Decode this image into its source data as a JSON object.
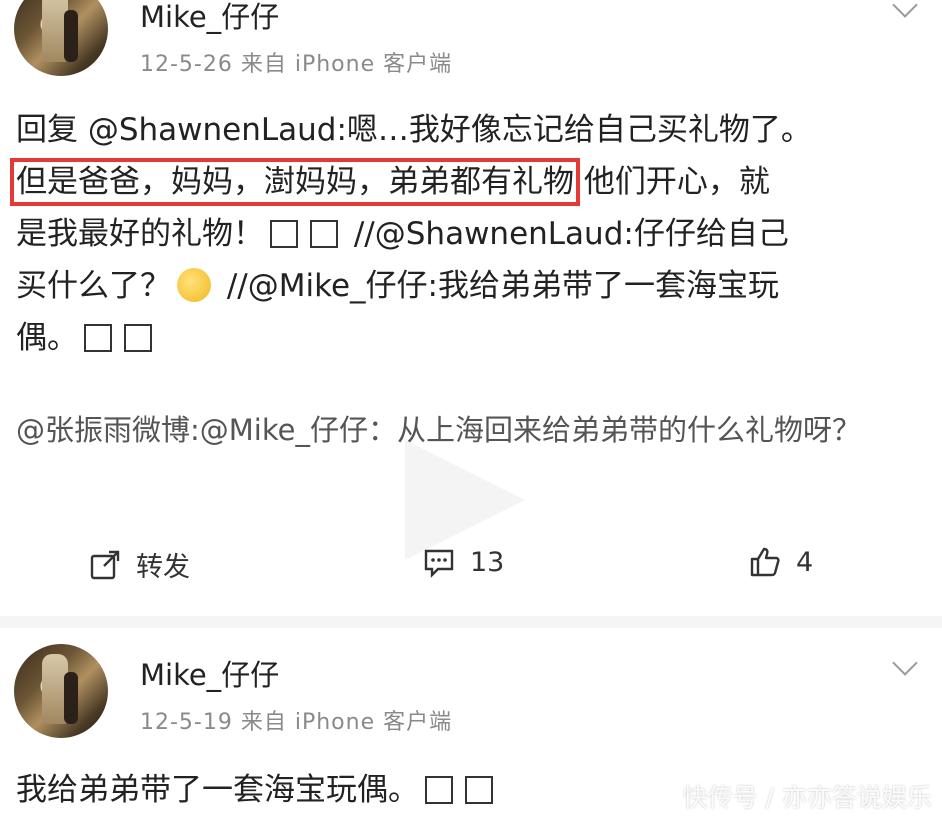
{
  "post1": {
    "username": "Mike_仔仔",
    "meta": "12-5-26  来自 iPhone 客户端",
    "line1": "回复 @ShawnenLaud:嗯…我好像忘记给自己买礼物了。",
    "highlight": "但是爸爸，妈妈，澍妈妈，弟弟都有礼物",
    "line2_rest": " 他们开心，就",
    "line3": "是我最好的礼物！",
    "line3_b": " //@ShawnenLaud:仔仔给自己",
    "line4": "买什么了？",
    "line4_b": " //@Mike_仔仔:我给弟弟带了一套海宝玩",
    "line5": "偶。",
    "quote": "@张振雨微博:@Mike_仔仔：从上海回来给弟弟带的什么礼物呀？",
    "actions": {
      "repost_label": "转发",
      "comment_count": "13",
      "like_count": "4"
    }
  },
  "post2": {
    "username": "Mike_仔仔",
    "meta": "12-5-19  来自 iPhone 客户端",
    "text": "我给弟弟带了一套海宝玩偶。"
  },
  "watermark": "快传号 / 亦亦答说娱乐",
  "icons": {
    "repost": "share-box-icon",
    "comment": "comment-icon",
    "like": "thumbs-up-icon",
    "more": "chevron-down-icon"
  }
}
